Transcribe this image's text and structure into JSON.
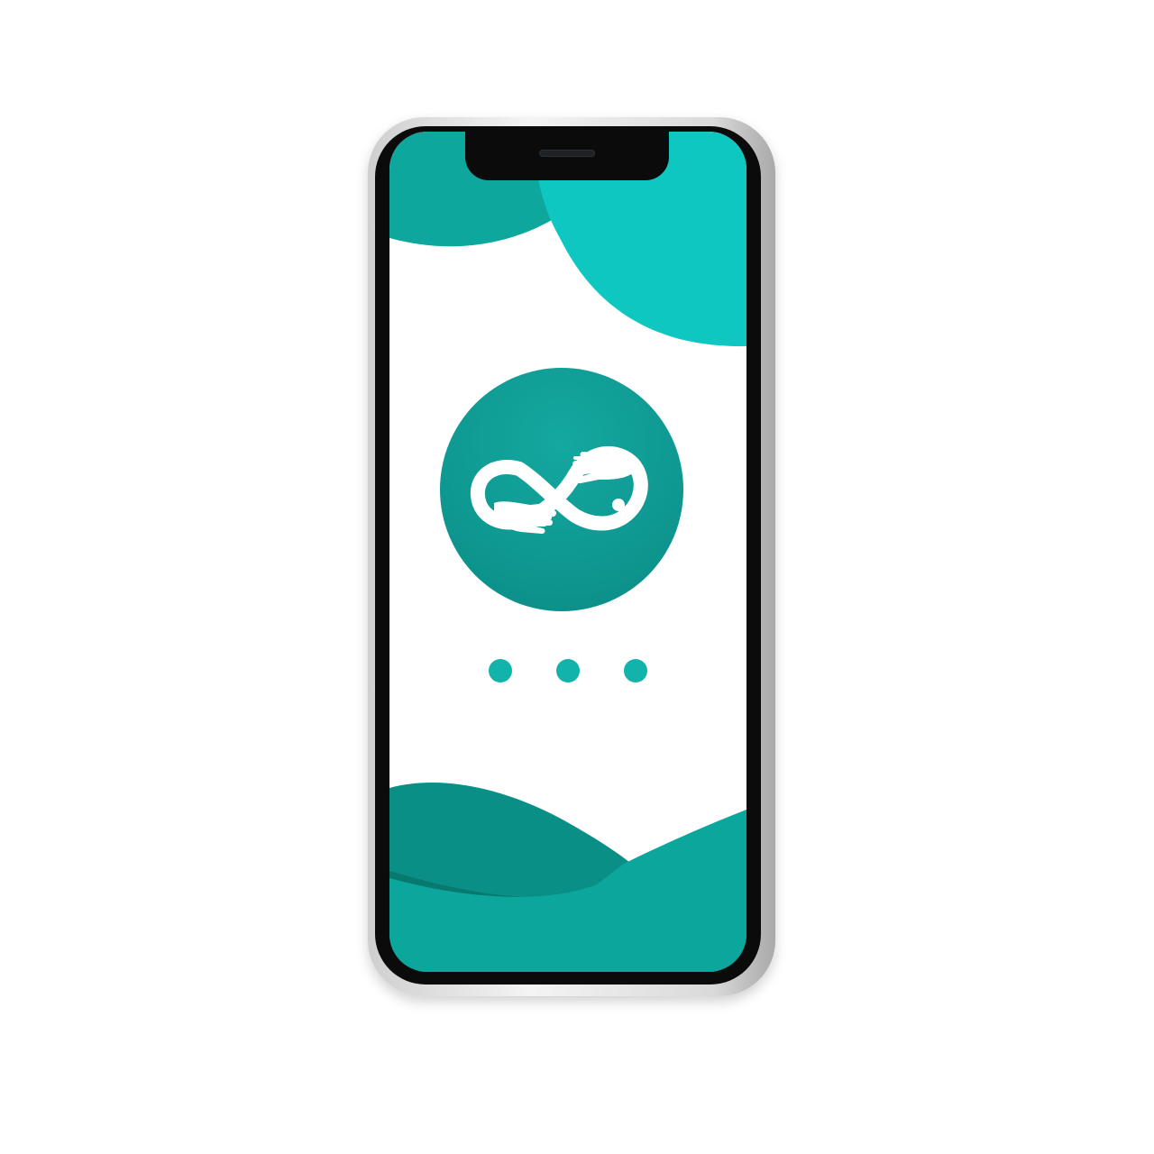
{
  "device": {
    "model_shape": "notched-smartphone",
    "frame_color": "#d9d9d9",
    "bezel_color": "#0b0b0c"
  },
  "splash_screen": {
    "background": "#ffffff",
    "colors": {
      "top_left_blob": "#0ea79e",
      "top_right_blob": "#0fc7c1",
      "bottom_wave_back": "#0a8f87",
      "bottom_wave_mid": "#07796f",
      "bottom_wave_front": "#0ba69c",
      "logo_circle": "#0e9891",
      "logo_mark": "#ffffff",
      "loading_dot": "#12b3ab"
    },
    "logo": {
      "icon": "infinity-hands-icon"
    },
    "loading_indicator": {
      "icon": "loading-dots",
      "dot_count": 3
    }
  }
}
